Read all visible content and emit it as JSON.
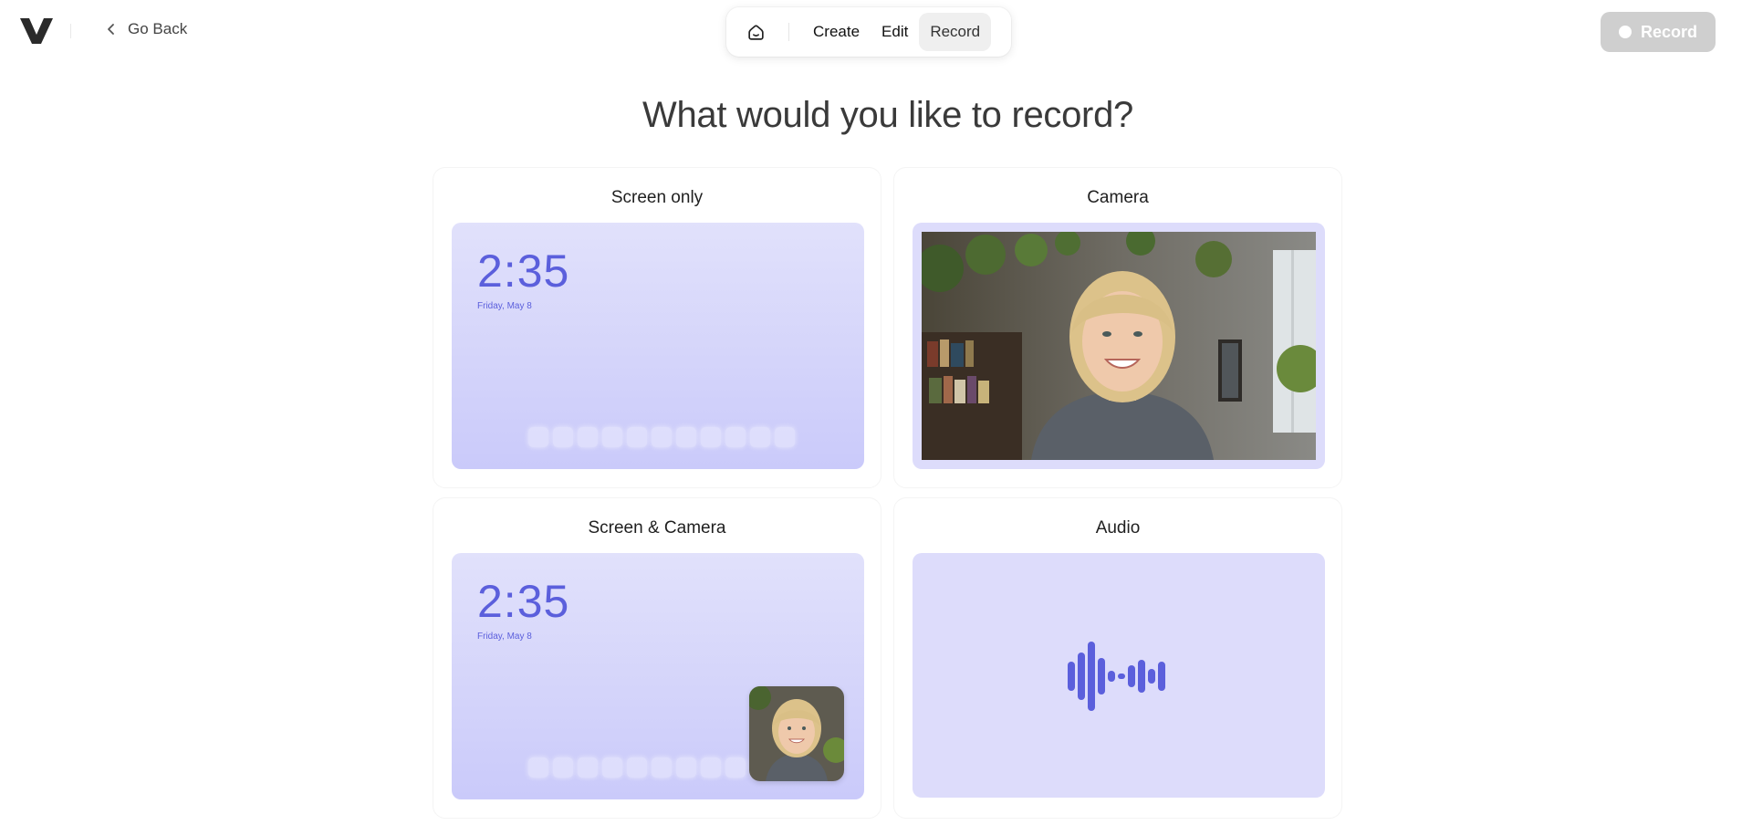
{
  "header": {
    "go_back_label": "Go Back",
    "nav": {
      "tabs": [
        {
          "label": "Create"
        },
        {
          "label": "Edit"
        },
        {
          "label": "Record"
        }
      ],
      "active": "Record"
    },
    "record_button_label": "Record"
  },
  "heading": "What would you like to record?",
  "cards": [
    {
      "title": "Screen only",
      "clock": "2:35",
      "date": "Friday, May 8"
    },
    {
      "title": "Camera"
    },
    {
      "title": "Screen & Camera",
      "clock": "2:35",
      "date": "Friday, May 8"
    },
    {
      "title": "Audio"
    }
  ],
  "icons": [
    "logo",
    "chevron-left-icon",
    "home-icon",
    "record-dot-icon",
    "audio-waveform-icon"
  ],
  "colors": {
    "accent": "#5b5fdc",
    "thumb_bg": "#dddcfb",
    "record_button_disabled": "#cfcfcf"
  }
}
